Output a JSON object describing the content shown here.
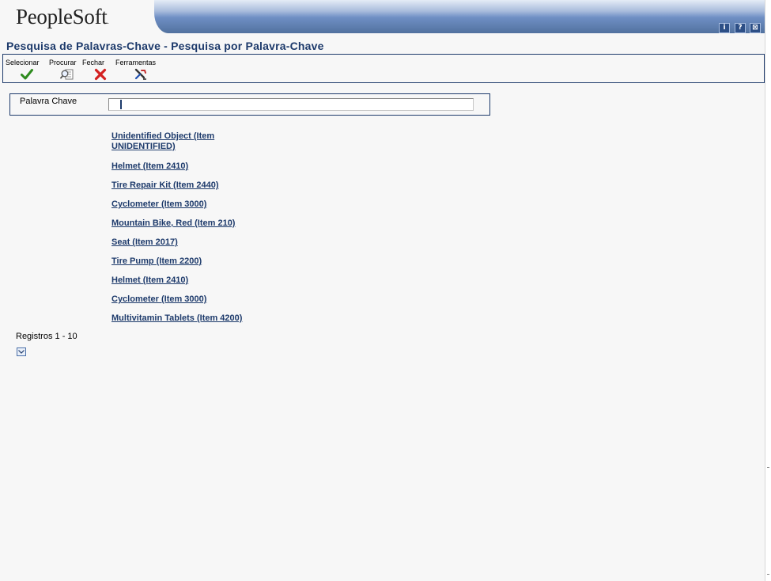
{
  "brand": {
    "logo_text": "PeopleSoft",
    "logo_mark": "."
  },
  "header_icons": [
    {
      "name": "info-icon",
      "glyph": "i"
    },
    {
      "name": "help-icon",
      "glyph": "?"
    },
    {
      "name": "personalize-icon",
      "glyph": "⊠"
    }
  ],
  "page_title": "Pesquisa de Palavras-Chave - Pesquisa por Palavra-Chave",
  "toolbar": {
    "select_label": "Selecionar",
    "find_label": "Procurar",
    "close_label": "Fechar",
    "tools_label": "Ferramentas"
  },
  "keyword": {
    "label": "Palavra Chave",
    "value": ""
  },
  "results": [
    "Unidentified Object (Item UNIDENTIFIED)",
    "Helmet (Item 2410)",
    "Tire Repair Kit (Item 2440)",
    "Cyclometer (Item 3000)",
    "Mountain Bike, Red (Item 210)",
    "Seat (Item 2017)",
    "Tire Pump (Item 2200)",
    "Helmet (Item 2410)",
    "Cyclometer (Item 3000)",
    "Multivitamin Tablets (Item 4200)"
  ],
  "records_label": "Registros 1 - 10",
  "colors": {
    "accent": "#1d3a6b",
    "check_green": "#2e8b1e",
    "close_red": "#d42020",
    "header_blue": "#52729f"
  }
}
